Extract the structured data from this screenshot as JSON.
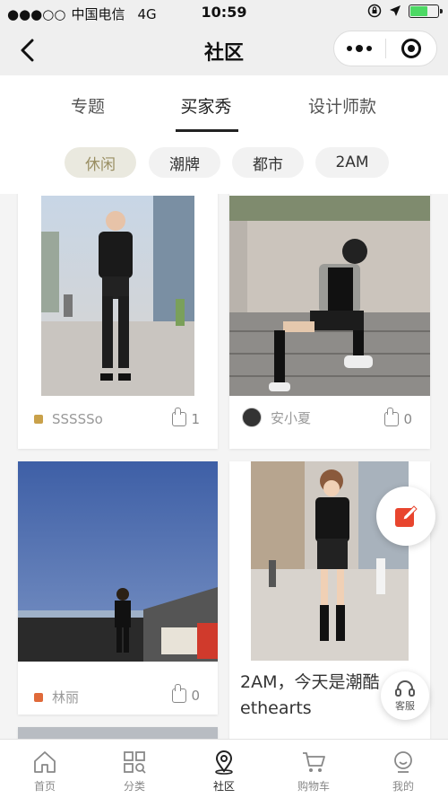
{
  "status_bar": {
    "carrier": "中国电信",
    "network": "4G",
    "time": "10:59",
    "signal": "●●●○○"
  },
  "nav": {
    "title": "社区"
  },
  "tabs": [
    {
      "label": "专题"
    },
    {
      "label": "买家秀",
      "active": true
    },
    {
      "label": "设计师款"
    }
  ],
  "filters": [
    {
      "label": "休闲",
      "active": true
    },
    {
      "label": "潮牌"
    },
    {
      "label": "都市"
    },
    {
      "label": "2AM"
    }
  ],
  "posts": [
    {
      "user": "SSSSSo",
      "likes": "1"
    },
    {
      "user": "安小夏",
      "likes": "0"
    },
    {
      "user": "林丽",
      "likes": "0"
    },
    {
      "caption": "2AM，今天是潮酷\nethearts"
    }
  ],
  "floating": {
    "service_label": "客服"
  },
  "tabbar": [
    {
      "label": "首页",
      "icon": "home-icon"
    },
    {
      "label": "分类",
      "icon": "category-icon"
    },
    {
      "label": "社区",
      "icon": "location-icon",
      "active": true
    },
    {
      "label": "购物车",
      "icon": "cart-icon"
    },
    {
      "label": "我的",
      "icon": "profile-icon"
    }
  ],
  "colors": {
    "accent_red": "#e8452e",
    "chip_active_text": "#9a8f63"
  }
}
